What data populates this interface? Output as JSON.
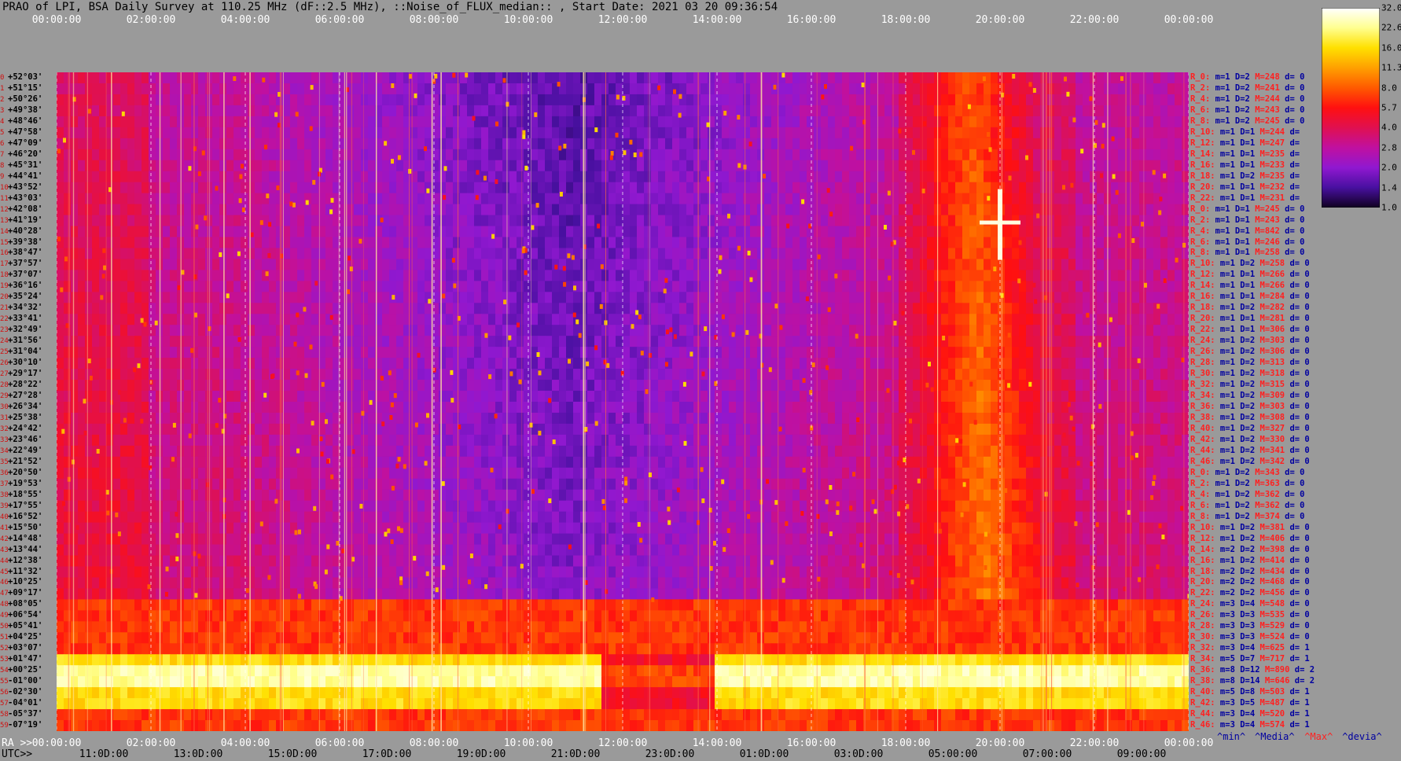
{
  "title": "PRAO of LPI, BSA Daily Survey at 110.25 MHz (dF::2.5 MHz), ::Noise_of_FLUX_median:: , Start Date: 2021 03 20 09:36:54",
  "top_ticks": [
    "00:00:00",
    "02:00:00",
    "04:00:00",
    "06:00:00",
    "08:00:00",
    "10:00:00",
    "12:00:00",
    "14:00:00",
    "16:00:00",
    "18:00:00",
    "20:00:00",
    "22:00:00",
    "00:00:00"
  ],
  "ra_label": "RA >>",
  "ra_ticks": [
    "00:00:00",
    "02:00:00",
    "04:00:00",
    "06:00:00",
    "08:00:00",
    "10:00:00",
    "12:00:00",
    "14:00:00",
    "16:00:00",
    "18:00:00",
    "20:00:00",
    "22:00:00",
    "00:00:00"
  ],
  "utc_label": "UTC>>",
  "utc_ticks": [
    "11:0D:00",
    "13:0D:00",
    "15:0D:00",
    "17:0D:00",
    "19:0D:00",
    "21:0D:00",
    "23:0D:00",
    "01:0D:00",
    "03:0D:00",
    "05:00:00",
    "07:00:00",
    "09:00:00"
  ],
  "footer_stats": [
    {
      "text": "^min^",
      "color": "#0000a0"
    },
    {
      "text": "^Media^",
      "color": "#0000a0"
    },
    {
      "text": "^Max^",
      "color": "#ff2020"
    },
    {
      "text": "^devia^",
      "color": "#0000a0"
    }
  ],
  "colorbar": {
    "labels": [
      "32.0",
      "22.6",
      "16.0",
      "11.3",
      "8.0",
      "5.7",
      "4.0",
      "2.8",
      "2.0",
      "1.4",
      "1.0"
    ],
    "stops": [
      "#ffffff",
      "#ffff90",
      "#ffe000",
      "#ffa000",
      "#ff5a00",
      "#ff1010",
      "#e01050",
      "#c010a0",
      "#9018d0",
      "#4810a0",
      "#100020"
    ]
  },
  "declinations": [
    {
      "i": "0",
      "v": "+52°03'"
    },
    {
      "i": "1",
      "v": "+51°15'"
    },
    {
      "i": "2",
      "v": "+50°26'"
    },
    {
      "i": "3",
      "v": "+49°38'"
    },
    {
      "i": "4",
      "v": "+48°46'"
    },
    {
      "i": "5",
      "v": "+47°58'"
    },
    {
      "i": "6",
      "v": "+47°09'"
    },
    {
      "i": "7",
      "v": "+46°20'"
    },
    {
      "i": "8",
      "v": "+45°31'"
    },
    {
      "i": "9",
      "v": "+44°41'"
    },
    {
      "i": "10",
      "v": "+43°52'"
    },
    {
      "i": "11",
      "v": "+43°03'"
    },
    {
      "i": "12",
      "v": "+42°08'"
    },
    {
      "i": "13",
      "v": "+41°19'"
    },
    {
      "i": "14",
      "v": "+40°28'"
    },
    {
      "i": "15",
      "v": "+39°38'"
    },
    {
      "i": "16",
      "v": "+38°47'"
    },
    {
      "i": "17",
      "v": "+37°57'"
    },
    {
      "i": "18",
      "v": "+37°07'"
    },
    {
      "i": "19",
      "v": "+36°16'"
    },
    {
      "i": "20",
      "v": "+35°24'"
    },
    {
      "i": "21",
      "v": "+34°32'"
    },
    {
      "i": "22",
      "v": "+33°41'"
    },
    {
      "i": "23",
      "v": "+32°49'"
    },
    {
      "i": "24",
      "v": "+31°56'"
    },
    {
      "i": "25",
      "v": "+31°04'"
    },
    {
      "i": "26",
      "v": "+30°10'"
    },
    {
      "i": "27",
      "v": "+29°17'"
    },
    {
      "i": "28",
      "v": "+28°22'"
    },
    {
      "i": "29",
      "v": "+27°28'"
    },
    {
      "i": "30",
      "v": "+26°34'"
    },
    {
      "i": "31",
      "v": "+25°38'"
    },
    {
      "i": "32",
      "v": "+24°42'"
    },
    {
      "i": "33",
      "v": "+23°46'"
    },
    {
      "i": "34",
      "v": "+22°49'"
    },
    {
      "i": "35",
      "v": "+21°52'"
    },
    {
      "i": "36",
      "v": "+20°50'"
    },
    {
      "i": "37",
      "v": "+19°53'"
    },
    {
      "i": "38",
      "v": "+18°55'"
    },
    {
      "i": "39",
      "v": "+17°55'"
    },
    {
      "i": "40",
      "v": "+16°52'"
    },
    {
      "i": "41",
      "v": "+15°50'"
    },
    {
      "i": "42",
      "v": "+14°48'"
    },
    {
      "i": "43",
      "v": "+13°44'"
    },
    {
      "i": "44",
      "v": "+12°38'"
    },
    {
      "i": "45",
      "v": "+11°32'"
    },
    {
      "i": "46",
      "v": "+10°25'"
    },
    {
      "i": "47",
      "v": "+09°17'"
    },
    {
      "i": "48",
      "v": "+08°05'"
    },
    {
      "i": "49",
      "v": "+06°54'"
    },
    {
      "i": "50",
      "v": "+05°41'"
    },
    {
      "i": "51",
      "v": "+04°25'"
    },
    {
      "i": "52",
      "v": "+03°07'"
    },
    {
      "i": "53",
      "v": "+01°47'"
    },
    {
      "i": "54",
      "v": "+00°25'"
    },
    {
      "i": "55",
      "v": "-01°00'"
    },
    {
      "i": "56",
      "v": "-02°30'"
    },
    {
      "i": "57",
      "v": "-04°01'"
    },
    {
      "i": "58",
      "v": "-05°37'"
    },
    {
      "i": "59",
      "v": "-07°19'"
    }
  ],
  "stats": [
    {
      "r": "R_0:",
      "m": "m=1",
      "d": "D=2",
      "h": "M=248",
      "dv": "d= 0"
    },
    {
      "r": "R_2:",
      "m": "m=1",
      "d": "D=2",
      "h": "M=241",
      "dv": "d= 0"
    },
    {
      "r": "R_4:",
      "m": "m=1",
      "d": "D=2",
      "h": "M=244",
      "dv": "d= 0"
    },
    {
      "r": "R_6:",
      "m": "m=1",
      "d": "D=2",
      "h": "M=243",
      "dv": "d= 0"
    },
    {
      "r": "R_8:",
      "m": "m=1",
      "d": "D=2",
      "h": "M=245",
      "dv": "d= 0"
    },
    {
      "r": "R_10:",
      "m": "m=1",
      "d": "D=1",
      "h": "M=244",
      "dv": "d="
    },
    {
      "r": "R_12:",
      "m": "m=1",
      "d": "D=1",
      "h": "M=247",
      "dv": "d="
    },
    {
      "r": "R_14:",
      "m": "m=1",
      "d": "D=1",
      "h": "M=235",
      "dv": "d="
    },
    {
      "r": "R_16:",
      "m": "m=1",
      "d": "D=1",
      "h": "M=233",
      "dv": "d="
    },
    {
      "r": "R_18:",
      "m": "m=1",
      "d": "D=2",
      "h": "M=235",
      "dv": "d="
    },
    {
      "r": "R_20:",
      "m": "m=1",
      "d": "D=1",
      "h": "M=232",
      "dv": "d="
    },
    {
      "r": "R_22:",
      "m": "m=1",
      "d": "D=1",
      "h": "M=231",
      "dv": "d="
    },
    {
      "r": "R_0:",
      "m": "m=1",
      "d": "D=1",
      "h": "M=245",
      "dv": "d= 0"
    },
    {
      "r": "R_2:",
      "m": "m=1",
      "d": "D=1",
      "h": "M=243",
      "dv": "d= 0"
    },
    {
      "r": "R_4:",
      "m": "m=1",
      "d": "D=1",
      "h": "M=842",
      "dv": "d= 0"
    },
    {
      "r": "R_6:",
      "m": "m=1",
      "d": "D=1",
      "h": "M=246",
      "dv": "d= 0"
    },
    {
      "r": "R_8:",
      "m": "m=1",
      "d": "D=1",
      "h": "M=258",
      "dv": "d= 0"
    },
    {
      "r": "R_10:",
      "m": "m=1",
      "d": "D=2",
      "h": "M=258",
      "dv": "d= 0"
    },
    {
      "r": "R_12:",
      "m": "m=1",
      "d": "D=1",
      "h": "M=266",
      "dv": "d= 0"
    },
    {
      "r": "R_14:",
      "m": "m=1",
      "d": "D=1",
      "h": "M=266",
      "dv": "d= 0"
    },
    {
      "r": "R_16:",
      "m": "m=1",
      "d": "D=1",
      "h": "M=284",
      "dv": "d= 0"
    },
    {
      "r": "R_18:",
      "m": "m=1",
      "d": "D=2",
      "h": "M=282",
      "dv": "d= 0"
    },
    {
      "r": "R_20:",
      "m": "m=1",
      "d": "D=1",
      "h": "M=281",
      "dv": "d= 0"
    },
    {
      "r": "R_22:",
      "m": "m=1",
      "d": "D=1",
      "h": "M=306",
      "dv": "d= 0"
    },
    {
      "r": "R_24:",
      "m": "m=1",
      "d": "D=2",
      "h": "M=303",
      "dv": "d= 0"
    },
    {
      "r": "R_26:",
      "m": "m=1",
      "d": "D=2",
      "h": "M=306",
      "dv": "d= 0"
    },
    {
      "r": "R_28:",
      "m": "m=1",
      "d": "D=2",
      "h": "M=313",
      "dv": "d= 0"
    },
    {
      "r": "R_30:",
      "m": "m=1",
      "d": "D=2",
      "h": "M=318",
      "dv": "d= 0"
    },
    {
      "r": "R_32:",
      "m": "m=1",
      "d": "D=2",
      "h": "M=315",
      "dv": "d= 0"
    },
    {
      "r": "R_34:",
      "m": "m=1",
      "d": "D=2",
      "h": "M=309",
      "dv": "d= 0"
    },
    {
      "r": "R_36:",
      "m": "m=1",
      "d": "D=2",
      "h": "M=303",
      "dv": "d= 0"
    },
    {
      "r": "R_38:",
      "m": "m=1",
      "d": "D=2",
      "h": "M=308",
      "dv": "d= 0"
    },
    {
      "r": "R_40:",
      "m": "m=1",
      "d": "D=2",
      "h": "M=327",
      "dv": "d= 0"
    },
    {
      "r": "R_42:",
      "m": "m=1",
      "d": "D=2",
      "h": "M=330",
      "dv": "d= 0"
    },
    {
      "r": "R_44:",
      "m": "m=1",
      "d": "D=2",
      "h": "M=341",
      "dv": "d= 0"
    },
    {
      "r": "R_46:",
      "m": "m=1",
      "d": "D=2",
      "h": "M=342",
      "dv": "d= 0"
    },
    {
      "r": "R_0:",
      "m": "m=1",
      "d": "D=2",
      "h": "M=343",
      "dv": "d= 0"
    },
    {
      "r": "R_2:",
      "m": "m=1",
      "d": "D=2",
      "h": "M=363",
      "dv": "d= 0"
    },
    {
      "r": "R_4:",
      "m": "m=1",
      "d": "D=2",
      "h": "M=362",
      "dv": "d= 0"
    },
    {
      "r": "R_6:",
      "m": "m=1",
      "d": "D=2",
      "h": "M=362",
      "dv": "d= 0"
    },
    {
      "r": "R_8:",
      "m": "m=1",
      "d": "D=2",
      "h": "M=374",
      "dv": "d= 0"
    },
    {
      "r": "R_10:",
      "m": "m=1",
      "d": "D=2",
      "h": "M=381",
      "dv": "d= 0"
    },
    {
      "r": "R_12:",
      "m": "m=1",
      "d": "D=2",
      "h": "M=406",
      "dv": "d= 0"
    },
    {
      "r": "R_14:",
      "m": "m=2",
      "d": "D=2",
      "h": "M=398",
      "dv": "d= 0"
    },
    {
      "r": "R_16:",
      "m": "m=1",
      "d": "D=2",
      "h": "M=414",
      "dv": "d= 0"
    },
    {
      "r": "R_18:",
      "m": "m=2",
      "d": "D=2",
      "h": "M=434",
      "dv": "d= 0"
    },
    {
      "r": "R_20:",
      "m": "m=2",
      "d": "D=2",
      "h": "M=468",
      "dv": "d= 0"
    },
    {
      "r": "R_22:",
      "m": "m=2",
      "d": "D=2",
      "h": "M=456",
      "dv": "d= 0"
    },
    {
      "r": "R_24:",
      "m": "m=3",
      "d": "D=4",
      "h": "M=548",
      "dv": "d= 0"
    },
    {
      "r": "R_26:",
      "m": "m=3",
      "d": "D=3",
      "h": "M=535",
      "dv": "d= 0"
    },
    {
      "r": "R_28:",
      "m": "m=3",
      "d": "D=3",
      "h": "M=529",
      "dv": "d= 0"
    },
    {
      "r": "R_30:",
      "m": "m=3",
      "d": "D=3",
      "h": "M=524",
      "dv": "d= 0"
    },
    {
      "r": "R_32:",
      "m": "m=3",
      "d": "D=4",
      "h": "M=625",
      "dv": "d= 1"
    },
    {
      "r": "R_34:",
      "m": "m=5",
      "d": "D=7",
      "h": "M=717",
      "dv": "d= 1"
    },
    {
      "r": "R_36:",
      "m": "m=8",
      "d": "D=12",
      "h": "M=890",
      "dv": "d= 2"
    },
    {
      "r": "R_38:",
      "m": "m=8",
      "d": "D=14",
      "h": "M=646",
      "dv": "d= 2"
    },
    {
      "r": "R_40:",
      "m": "m=5",
      "d": "D=8",
      "h": "M=503",
      "dv": "d= 1"
    },
    {
      "r": "R_42:",
      "m": "m=3",
      "d": "D=5",
      "h": "M=487",
      "dv": "d= 1"
    },
    {
      "r": "R_44:",
      "m": "m=3",
      "d": "D=4",
      "h": "M=520",
      "dv": "d= 1"
    },
    {
      "r": "R_46:",
      "m": "m=3",
      "d": "D=4",
      "h": "M=574",
      "dv": "d= 1"
    }
  ],
  "chart_data": {
    "type": "heatmap",
    "x_unit": "RA (hours)",
    "x_range": [
      0,
      24
    ],
    "rows": 60,
    "color_scale": "log",
    "value_range": [
      1.0,
      32.0
    ],
    "band_rows": {
      "quiet_upper": [
        0,
        47
      ],
      "enhanced": [
        48,
        59
      ],
      "galactic_plane_bright": [
        53,
        57
      ]
    },
    "galactic_crossing_ra": 20.0,
    "bright_source": {
      "ra": 20.0,
      "row": 13
    },
    "row_max": [
      248,
      241,
      244,
      243,
      245,
      244,
      247,
      235,
      233,
      235,
      232,
      231,
      245,
      243,
      842,
      246,
      258,
      258,
      266,
      266,
      284,
      282,
      281,
      306,
      303,
      306,
      313,
      318,
      315,
      309,
      303,
      308,
      327,
      330,
      341,
      342,
      343,
      363,
      362,
      362,
      374,
      381,
      406,
      398,
      414,
      434,
      468,
      456,
      548,
      535,
      529,
      524,
      625,
      717,
      890,
      646,
      503,
      487,
      520,
      574
    ]
  }
}
